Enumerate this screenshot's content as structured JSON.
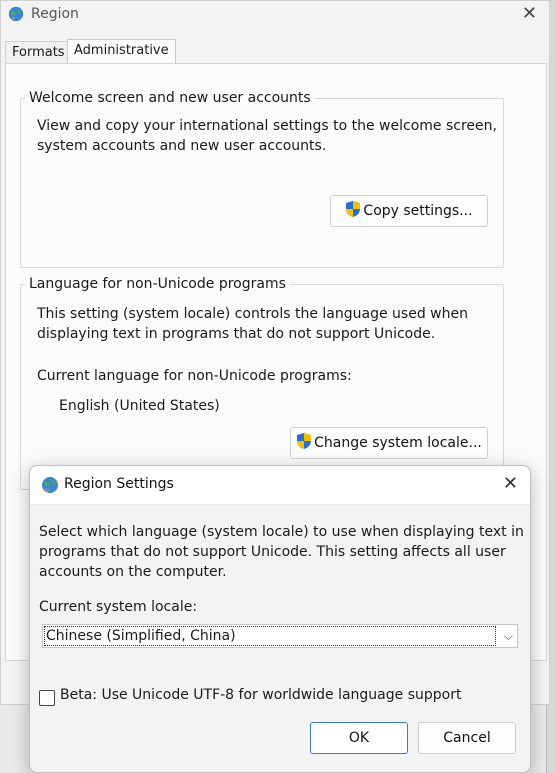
{
  "region_window": {
    "title": "Region",
    "close_glyph": "✕",
    "tabs": [
      {
        "label": "Formats"
      },
      {
        "label": "Administrative"
      }
    ],
    "welcome_group": {
      "legend": "Welcome screen and new user accounts",
      "description_line1": "View and copy your international settings to the welcome screen,",
      "description_line2": "system accounts and new user accounts.",
      "copy_button": "Copy settings..."
    },
    "nonunicode_group": {
      "legend": "Language for non-Unicode programs",
      "description_line1": "This setting (system locale) controls the language used when",
      "description_line2": "displaying text in programs that do not support Unicode.",
      "current_label": "Current language for non-Unicode programs:",
      "current_value": "English (United States)",
      "change_button": "Change system locale..."
    }
  },
  "region_settings_dialog": {
    "title": "Region Settings",
    "close_glyph": "✕",
    "description_line1": "Select which language (system locale) to use when displaying text in",
    "description_line2": "programs that do not support Unicode. This setting affects all user",
    "description_line3": "accounts on the computer.",
    "locale_label": "Current system locale:",
    "locale_value": "Chinese (Simplified, China)",
    "beta_checkbox_label": "Beta: Use Unicode UTF-8 for worldwide language support",
    "beta_checked": false,
    "ok_button": "OK",
    "cancel_button": "Cancel"
  },
  "icons": {
    "globe": "globe-icon",
    "shield": "uac-shield-icon",
    "dropdown": "chevron-down-icon"
  },
  "colors": {
    "shield_blue": "#2b6cd4",
    "shield_yellow": "#f2c200",
    "ok_border": "#3a7bd5"
  }
}
